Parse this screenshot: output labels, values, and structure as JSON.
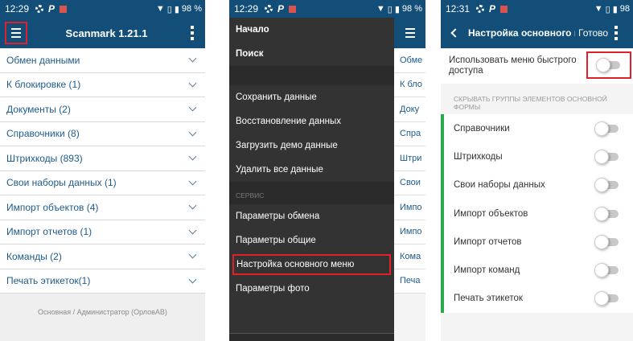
{
  "screen1": {
    "status": {
      "time": "12:29",
      "battery": "98 %"
    },
    "title": "Scanmark 1.21.1",
    "rows": [
      {
        "label": "Обмен данными"
      },
      {
        "label": "К блокировке (1)"
      },
      {
        "label": "Документы (2)"
      },
      {
        "label": "Справочники (8)"
      },
      {
        "label": "Штрихкоды (893)"
      },
      {
        "label": "Свои наборы данных (1)"
      },
      {
        "label": "Импорт объектов (4)"
      },
      {
        "label": "Импорт отчетов (1)"
      },
      {
        "label": "Команды (2)"
      },
      {
        "label": "Печать этикеток(1)"
      }
    ],
    "footer": "Основная / Администратор (ОрловАВ)"
  },
  "screen2": {
    "status": {
      "time": "12:29",
      "battery": "98 %"
    },
    "drawer": {
      "top_items": [
        "Начало",
        "Поиск"
      ],
      "data_items": [
        "Сохранить данные",
        "Восстановление данных",
        "Загрузить демо данные",
        "Удалить все данные"
      ],
      "service_header": "СЕРВИС",
      "service_items": [
        "Параметры обмена",
        "Параметры общие",
        "Настройка основного меню",
        "Параметры фото"
      ]
    },
    "peek_rows": [
      "Обме",
      "К бло",
      "Доку",
      "Спра",
      "Штри",
      "Свои",
      "Импо",
      "Импо",
      "Кома",
      "Печа"
    ]
  },
  "screen3": {
    "status": {
      "time": "12:31",
      "battery": "98"
    },
    "title": "Настройка основного м...",
    "done": "Готово",
    "quick_menu_label": "Использовать меню быстрого доступа",
    "section_header": "СКРЫВАТЬ ГРУППЫ ЭЛЕМЕНТОВ ОСНОВНОЙ ФОРМЫ",
    "groups": [
      {
        "label": "Справочники"
      },
      {
        "label": "Штрихкоды"
      },
      {
        "label": "Свои наборы данных"
      },
      {
        "label": "Импорт объектов"
      },
      {
        "label": "Импорт отчетов"
      },
      {
        "label": "Импорт команд"
      },
      {
        "label": "Печать этикеток"
      }
    ]
  },
  "colors": {
    "appbar": "#124e78",
    "highlight": "#e0202a",
    "accent_green": "#2aa84a",
    "drawer": "#333333"
  }
}
